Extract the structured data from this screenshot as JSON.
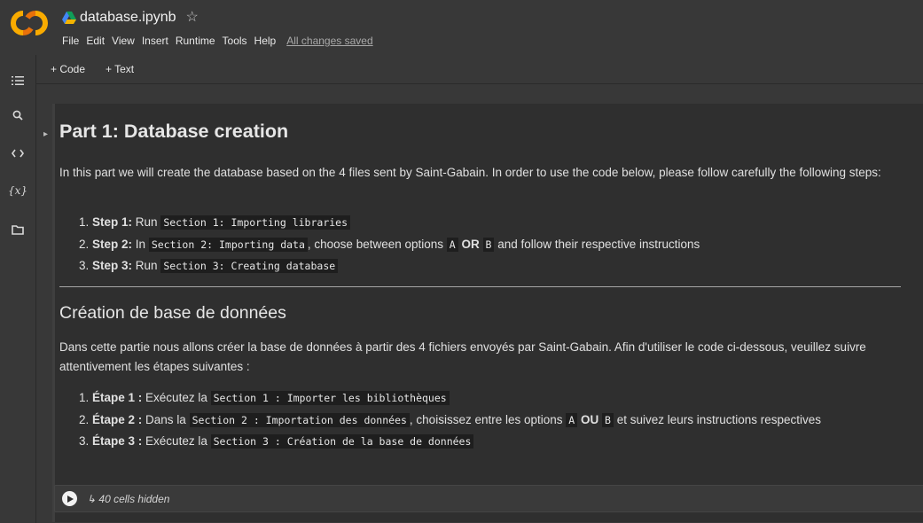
{
  "header": {
    "title": "database.ipynb",
    "star": "☆",
    "menu": [
      "File",
      "Edit",
      "View",
      "Insert",
      "Runtime",
      "Tools",
      "Help"
    ],
    "saved_status": "All changes saved"
  },
  "toolbar": {
    "add_code": "+ Code",
    "add_text": "+ Text"
  },
  "rail_icons": [
    "table-of-contents-icon",
    "search-icon",
    "code-snippets-icon",
    "variables-icon",
    "files-icon"
  ],
  "content": {
    "part_title": "Part 1: Database creation",
    "intro": "In this part we will create the database based on the 4 files sent by Saint-Gabain. In order to use the code below, please follow carefully the following steps:",
    "steps_en": [
      {
        "label": "Step 1:",
        "pre": "Run",
        "code": "Section 1: Importing libraries"
      },
      {
        "label": "Step 2:",
        "pre": "In",
        "code": "Section 2: Importing data",
        "mid": ", choose between options",
        "opt_a": "A",
        "or": "OR",
        "opt_b": "B",
        "post": "and follow their respective instructions"
      },
      {
        "label": "Step 3:",
        "pre": "Run",
        "code": "Section 3: Creating database"
      }
    ],
    "fr_title": "Création de base de données",
    "fr_intro": "Dans cette partie nous allons créer la base de données à partir des 4 fichiers envoyés par Saint-Gabain. Afin d'utiliser le code ci-dessous, veuillez suivre attentivement les étapes suivantes :",
    "steps_fr": [
      {
        "label": "Étape 1 :",
        "pre": "Exécutez la",
        "code": "Section 1 : Importer les bibliothèques"
      },
      {
        "label": "Étape 2 :",
        "pre": "Dans la",
        "code": "Section 2 : Importation des données",
        "mid": ", choisissez entre les options",
        "opt_a": "A",
        "or": "OU",
        "opt_b": "B",
        "post": "et suivez leurs instructions respectives"
      },
      {
        "label": "Étape 3 :",
        "pre": "Exécutez la",
        "code": "Section 3 : Création de la base de données"
      }
    ]
  },
  "hidden_cells": "↳ 40 cells hidden"
}
